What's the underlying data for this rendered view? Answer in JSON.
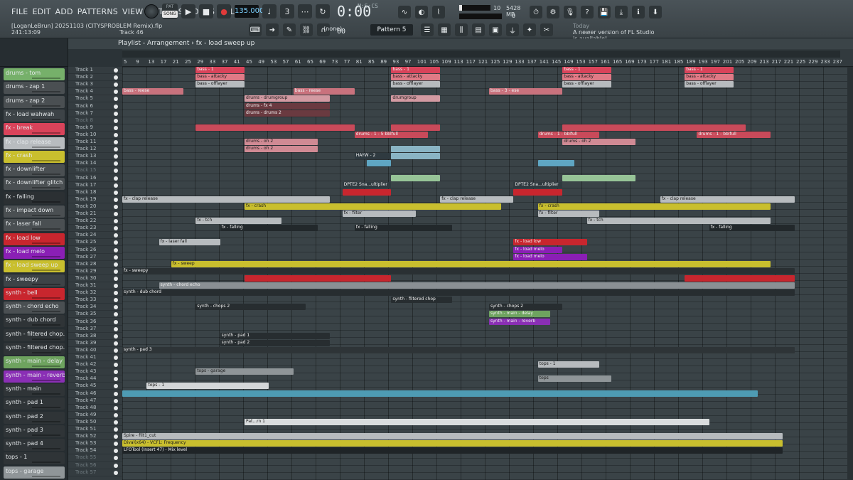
{
  "menu": [
    "FILE",
    "EDIT",
    "ADD",
    "PATTERNS",
    "VIEW",
    "OPTIONS",
    "TOOLS",
    "HELP"
  ],
  "project": {
    "file": "[LoganLeBrun] 20251103 (CITYSPROBLEM Remix).flp",
    "time": "241:13:09",
    "hint": "Track 46"
  },
  "transport": {
    "pat_label": "PAT",
    "song_label": "SONG",
    "tempo": "135.000",
    "time_main": "0:00",
    "time_sub": "00",
    "time_unit": "M:S:CS"
  },
  "cpu": {
    "poly": "10",
    "memory": "5428 MB",
    "poly_alt": "0"
  },
  "pattern": {
    "name": "Pattern 5",
    "snap": "(none)"
  },
  "news": {
    "today": "Today",
    "message": "A newer version of FL Studio is available!"
  },
  "playlist": {
    "title": "Playlist - Arrangement",
    "breadcrumb": "fx - load sweep up"
  },
  "bar_numbers": [
    "5",
    "9",
    "13",
    "17",
    "21",
    "25",
    "29",
    "33",
    "37",
    "41",
    "45",
    "49",
    "53",
    "57",
    "61",
    "65",
    "69",
    "73",
    "77",
    "81",
    "85",
    "89",
    "93",
    "97",
    "101",
    "105",
    "109",
    "113",
    "117",
    "121",
    "125",
    "129",
    "133",
    "137",
    "141",
    "145",
    "149",
    "153",
    "157",
    "161",
    "165",
    "169",
    "173",
    "177",
    "181",
    "185",
    "189",
    "193",
    "197",
    "201",
    "205",
    "209",
    "213",
    "217",
    "221",
    "225",
    "229",
    "233",
    "237"
  ],
  "channels": [
    {
      "name": "drums - tom",
      "color": "#76b06a"
    },
    {
      "name": "drums - zap 1",
      "color": "#4a4f52"
    },
    {
      "name": "drums - zap 2",
      "color": "#4a4f52"
    },
    {
      "name": "fx - load wahwah",
      "color": "#3d4347"
    },
    {
      "name": "fx - break",
      "color": "#d9435a"
    },
    {
      "name": "fx - clap release",
      "color": "#b8bcbf"
    },
    {
      "name": "fx - crash",
      "color": "#c9bf2e"
    },
    {
      "name": "fx - downlifter",
      "color": "#4a4f52"
    },
    {
      "name": "fx - downlifter glitch",
      "color": "#4a4f52"
    },
    {
      "name": "fx - falling",
      "color": "#2b3033"
    },
    {
      "name": "fx - impact down",
      "color": "#4a4f52"
    },
    {
      "name": "fx - laser fall",
      "color": "#4a4f52"
    },
    {
      "name": "fx - load low",
      "color": "#c8262e"
    },
    {
      "name": "fx - load melo",
      "color": "#8a1fb5"
    },
    {
      "name": "fx - load sweep up",
      "color": "#c9bf2e"
    },
    {
      "name": "fx - sweepy",
      "color": "#3d4347"
    },
    {
      "name": "synth - bell",
      "color": "#c8262e"
    },
    {
      "name": "synth - chord echo",
      "color": "#4a4f52"
    },
    {
      "name": "synth - dub chord",
      "color": "#2f3437"
    },
    {
      "name": "synth - filtered chop...",
      "color": "#2f3437"
    },
    {
      "name": "synth - filtered chop...",
      "color": "#2f3437"
    },
    {
      "name": "synth - main - delay",
      "color": "#6ea35f"
    },
    {
      "name": "synth - main - reverb",
      "color": "#8a2fb5"
    },
    {
      "name": "synth - main",
      "color": "#2f3437"
    },
    {
      "name": "synth - pad 1",
      "color": "#2f3437"
    },
    {
      "name": "synth - pad 2",
      "color": "#2f3437"
    },
    {
      "name": "synth - pad 3",
      "color": "#2f3437"
    },
    {
      "name": "synth - pad 4",
      "color": "#2f3437"
    },
    {
      "name": "tops - 1",
      "color": "#2f3437"
    },
    {
      "name": "tops - garage",
      "color": "#8f9598"
    }
  ],
  "tracks": [
    "Track 1",
    "Track 2",
    "Track 3",
    "Track 4",
    "Track 5",
    "Track 6",
    "Track 7",
    "Track 8",
    "Track 9",
    "Track 10",
    "Track 11",
    "Track 12",
    "Track 13",
    "Track 14",
    "Track 15",
    "Track 16",
    "Track 17",
    "Track 18",
    "Track 19",
    "Track 20",
    "Track 21",
    "Track 22",
    "Track 23",
    "Track 24",
    "Track 25",
    "Track 26",
    "Track 27",
    "Track 28",
    "Track 29",
    "Track 30",
    "Track 31",
    "Track 32",
    "Track 33",
    "Track 34",
    "Track 35",
    "Track 36",
    "Track 37",
    "Track 38",
    "Track 39",
    "Track 40",
    "Track 41",
    "Track 42",
    "Track 43",
    "Track 44",
    "Track 45",
    "Track 46",
    "Track 47",
    "Track 48",
    "Track 49",
    "Track 50",
    "Track 51",
    "Track 52",
    "Track 53",
    "Track 54",
    "Track 55",
    "Track 56",
    "Track 57"
  ],
  "dim_tracks": [
    8,
    15,
    55,
    56,
    57
  ],
  "clips": [
    {
      "track": 1,
      "start": 25,
      "len": 16,
      "label": "bass - 1",
      "color": "#d9435a"
    },
    {
      "track": 1,
      "start": 89,
      "len": 16,
      "label": "bass - 1",
      "color": "#d9435a"
    },
    {
      "track": 1,
      "start": 145,
      "len": 16,
      "label": "bass - 1",
      "color": "#d9435a"
    },
    {
      "track": 1,
      "start": 185,
      "len": 16,
      "label": "bass - 1",
      "color": "#d9435a"
    },
    {
      "track": 2,
      "start": 25,
      "len": 16,
      "label": "bass - attacky",
      "color": "#e07a86"
    },
    {
      "track": 2,
      "start": 89,
      "len": 16,
      "label": "bass - attacky",
      "color": "#e07a86"
    },
    {
      "track": 2,
      "start": 145,
      "len": 16,
      "label": "bass - attacky",
      "color": "#e07a86"
    },
    {
      "track": 2,
      "start": 185,
      "len": 16,
      "label": "bass - attacky",
      "color": "#e07a86"
    },
    {
      "track": 3,
      "start": 25,
      "len": 16,
      "label": "bass - offlayer",
      "color": "#b7bbbe"
    },
    {
      "track": 3,
      "start": 89,
      "len": 16,
      "label": "bass - offlayer",
      "color": "#b7bbbe"
    },
    {
      "track": 3,
      "start": 145,
      "len": 16,
      "label": "bass - offlayer",
      "color": "#b7bbbe"
    },
    {
      "track": 3,
      "start": 185,
      "len": 16,
      "label": "bass - offlayer",
      "color": "#b7bbbe"
    },
    {
      "track": 4,
      "start": 1,
      "len": 20,
      "label": "bass - reese",
      "color": "#c9727d"
    },
    {
      "track": 4,
      "start": 57,
      "len": 20,
      "label": "bass - reese",
      "color": "#c9727d"
    },
    {
      "track": 4,
      "start": 121,
      "len": 24,
      "label": "bass - 3 - ese",
      "color": "#c9727d"
    },
    {
      "track": 5,
      "start": 41,
      "len": 28,
      "label": "drums - drumgroup",
      "color": "#d39aa2"
    },
    {
      "track": 5,
      "start": 89,
      "len": 16,
      "label": "drumgroup",
      "color": "#d39aa2"
    },
    {
      "track": 6,
      "start": 41,
      "len": 28,
      "label": "drums - fx 4",
      "color": "#6a3a40"
    },
    {
      "track": 7,
      "start": 41,
      "len": 28,
      "label": "drums - drums 2",
      "color": "#6a3a40"
    },
    {
      "track": 9,
      "start": 25,
      "len": 52,
      "label": "",
      "color": "#c94a5a"
    },
    {
      "track": 9,
      "start": 89,
      "len": 16,
      "label": "",
      "color": "#c94a5a"
    },
    {
      "track": 9,
      "start": 145,
      "len": 60,
      "label": "",
      "color": "#c94a5a"
    },
    {
      "track": 10,
      "start": 77,
      "len": 24,
      "label": "drums - 1 - 5 bblfull",
      "color": "#c94a5a"
    },
    {
      "track": 10,
      "start": 137,
      "len": 20,
      "label": "drums - 1 - bblfull",
      "color": "#c94a5a"
    },
    {
      "track": 10,
      "start": 189,
      "len": 24,
      "label": "drums - 1 - bblfull",
      "color": "#c94a5a"
    },
    {
      "track": 11,
      "start": 41,
      "len": 24,
      "label": "drums - oh 2",
      "color": "#d08a94"
    },
    {
      "track": 11,
      "start": 145,
      "len": 24,
      "label": "drums - oh 2",
      "color": "#d08a94"
    },
    {
      "track": 12,
      "start": 41,
      "len": 24,
      "label": "drums - oh 2",
      "color": "#d08a94"
    },
    {
      "track": 12,
      "start": 89,
      "len": 16,
      "label": "",
      "color": "#8ab4c4"
    },
    {
      "track": 13,
      "start": 77,
      "len": 12,
      "label": "HAYW - 2",
      "color": "#2f3a40"
    },
    {
      "track": 13,
      "start": 89,
      "len": 16,
      "label": "",
      "color": "#8ab4c4"
    },
    {
      "track": 14,
      "start": 81,
      "len": 8,
      "label": "",
      "color": "#5fa6c3"
    },
    {
      "track": 14,
      "start": 137,
      "len": 12,
      "label": "",
      "color": "#5fa6c3"
    },
    {
      "track": 16,
      "start": 89,
      "len": 16,
      "label": "",
      "color": "#97c497"
    },
    {
      "track": 16,
      "start": 145,
      "len": 24,
      "label": "",
      "color": "#97c497"
    },
    {
      "track": 17,
      "start": 73,
      "len": 16,
      "label": "DPTE2 Sna...ultiplier",
      "color": "#303a3f"
    },
    {
      "track": 17,
      "start": 129,
      "len": 16,
      "label": "DPTE2 Sna...ultiplier",
      "color": "#303a3f"
    },
    {
      "track": 18,
      "start": 73,
      "len": 16,
      "label": "",
      "color": "#c8262e"
    },
    {
      "track": 18,
      "start": 129,
      "len": 16,
      "label": "",
      "color": "#c8262e"
    },
    {
      "track": 19,
      "start": 1,
      "len": 68,
      "label": "fx - clap release",
      "color": "#b8bcbf"
    },
    {
      "track": 19,
      "start": 105,
      "len": 24,
      "label": "fx - clap release",
      "color": "#b8bcbf"
    },
    {
      "track": 19,
      "start": 177,
      "len": 44,
      "label": "fx - clap release",
      "color": "#b8bcbf"
    },
    {
      "track": 20,
      "start": 41,
      "len": 84,
      "label": "fx - crash",
      "color": "#c9bf2e"
    },
    {
      "track": 20,
      "start": 137,
      "len": 76,
      "label": "fx - crash",
      "color": "#c9bf2e"
    },
    {
      "track": 21,
      "start": 73,
      "len": 24,
      "label": "fx - filter",
      "color": "#b7bbbe"
    },
    {
      "track": 21,
      "start": 137,
      "len": 20,
      "label": "fx - filter",
      "color": "#b7bbbe"
    },
    {
      "track": 22,
      "start": 25,
      "len": 28,
      "label": "fx - tch",
      "color": "#b7bbbe"
    },
    {
      "track": 22,
      "start": 153,
      "len": 60,
      "label": "fx - tch",
      "color": "#b7bbbe"
    },
    {
      "track": 23,
      "start": 33,
      "len": 32,
      "label": "fx - falling",
      "color": "#22282b"
    },
    {
      "track": 23,
      "start": 77,
      "len": 32,
      "label": "fx - falling",
      "color": "#22282b"
    },
    {
      "track": 23,
      "start": 193,
      "len": 28,
      "label": "fx - falling",
      "color": "#22282b"
    },
    {
      "track": 25,
      "start": 13,
      "len": 20,
      "label": "fx - laser fall",
      "color": "#b7bbbe"
    },
    {
      "track": 25,
      "start": 129,
      "len": 24,
      "label": "fx - load low",
      "color": "#c8262e"
    },
    {
      "track": 26,
      "start": 129,
      "len": 16,
      "label": "fx - load melo",
      "color": "#8a1fb5"
    },
    {
      "track": 27,
      "start": 129,
      "len": 24,
      "label": "fx - load melo",
      "color": "#8a1fb5"
    },
    {
      "track": 28,
      "start": 17,
      "len": 196,
      "label": "fx - sweep",
      "color": "#c9bf2e"
    },
    {
      "track": 29,
      "start": 1,
      "len": 220,
      "label": "fx - sweepy",
      "color": "#2a3033"
    },
    {
      "track": 30,
      "start": 41,
      "len": 48,
      "label": "",
      "color": "#c8262e"
    },
    {
      "track": 30,
      "start": 185,
      "len": 36,
      "label": "",
      "color": "#c8262e"
    },
    {
      "track": 31,
      "start": 13,
      "len": 208,
      "label": "synth - chord echo",
      "color": "#8a9094"
    },
    {
      "track": 32,
      "start": 1,
      "len": 220,
      "label": "synth - dub chord",
      "color": "#272d30"
    },
    {
      "track": 33,
      "start": 89,
      "len": 20,
      "label": "synth - filtered chop",
      "color": "#272d30"
    },
    {
      "track": 34,
      "start": 25,
      "len": 36,
      "label": "synth - chops 2",
      "color": "#272d30"
    },
    {
      "track": 34,
      "start": 121,
      "len": 24,
      "label": "synth - chops 2",
      "color": "#272d30"
    },
    {
      "track": 35,
      "start": 121,
      "len": 20,
      "label": "synth - main - delay",
      "color": "#6ea35f"
    },
    {
      "track": 36,
      "start": 121,
      "len": 20,
      "label": "synth - main - reverb",
      "color": "#8a2fb5"
    },
    {
      "track": 38,
      "start": 33,
      "len": 36,
      "label": "synth - pad 1",
      "color": "#272d30"
    },
    {
      "track": 39,
      "start": 33,
      "len": 36,
      "label": "synth - pad 2",
      "color": "#272d30"
    },
    {
      "track": 40,
      "start": 1,
      "len": 220,
      "label": "synth - pad 3",
      "color": "#2e3437"
    },
    {
      "track": 42,
      "start": 137,
      "len": 20,
      "label": "tops - 1",
      "color": "#b7bbbe"
    },
    {
      "track": 43,
      "start": 25,
      "len": 32,
      "label": "tops - garage",
      "color": "#8f9598"
    },
    {
      "track": 44,
      "start": 137,
      "len": 24,
      "label": "tops",
      "color": "#8f9598"
    },
    {
      "track": 45,
      "start": 9,
      "len": 40,
      "label": "tops - 1",
      "color": "#d3d6d8"
    },
    {
      "track": 46,
      "start": 1,
      "len": 208,
      "label": "",
      "color": "#4e9bb3"
    },
    {
      "track": 50,
      "start": 41,
      "len": 152,
      "label": "Pat...rn 1",
      "color": "#d9dcdd"
    },
    {
      "track": 52,
      "start": 1,
      "len": 216,
      "label": "Spire - filt1_cut",
      "color": "#b7bbbe"
    },
    {
      "track": 53,
      "start": 1,
      "len": 216,
      "label": "Dival(x64) - VCF1: Frequency",
      "color": "#c9bf2e"
    },
    {
      "track": 54,
      "start": 1,
      "len": 216,
      "label": "LFOTool (Insert 47) - Mix level",
      "color": "#1f2427"
    }
  ],
  "ui": {
    "accent": "#7cd1ff",
    "icons": [
      "knob-icon",
      "play-icon",
      "stop-icon",
      "record-icon",
      "snap-icon",
      "mixer-icon",
      "plugin-icon",
      "settings-icon"
    ]
  }
}
